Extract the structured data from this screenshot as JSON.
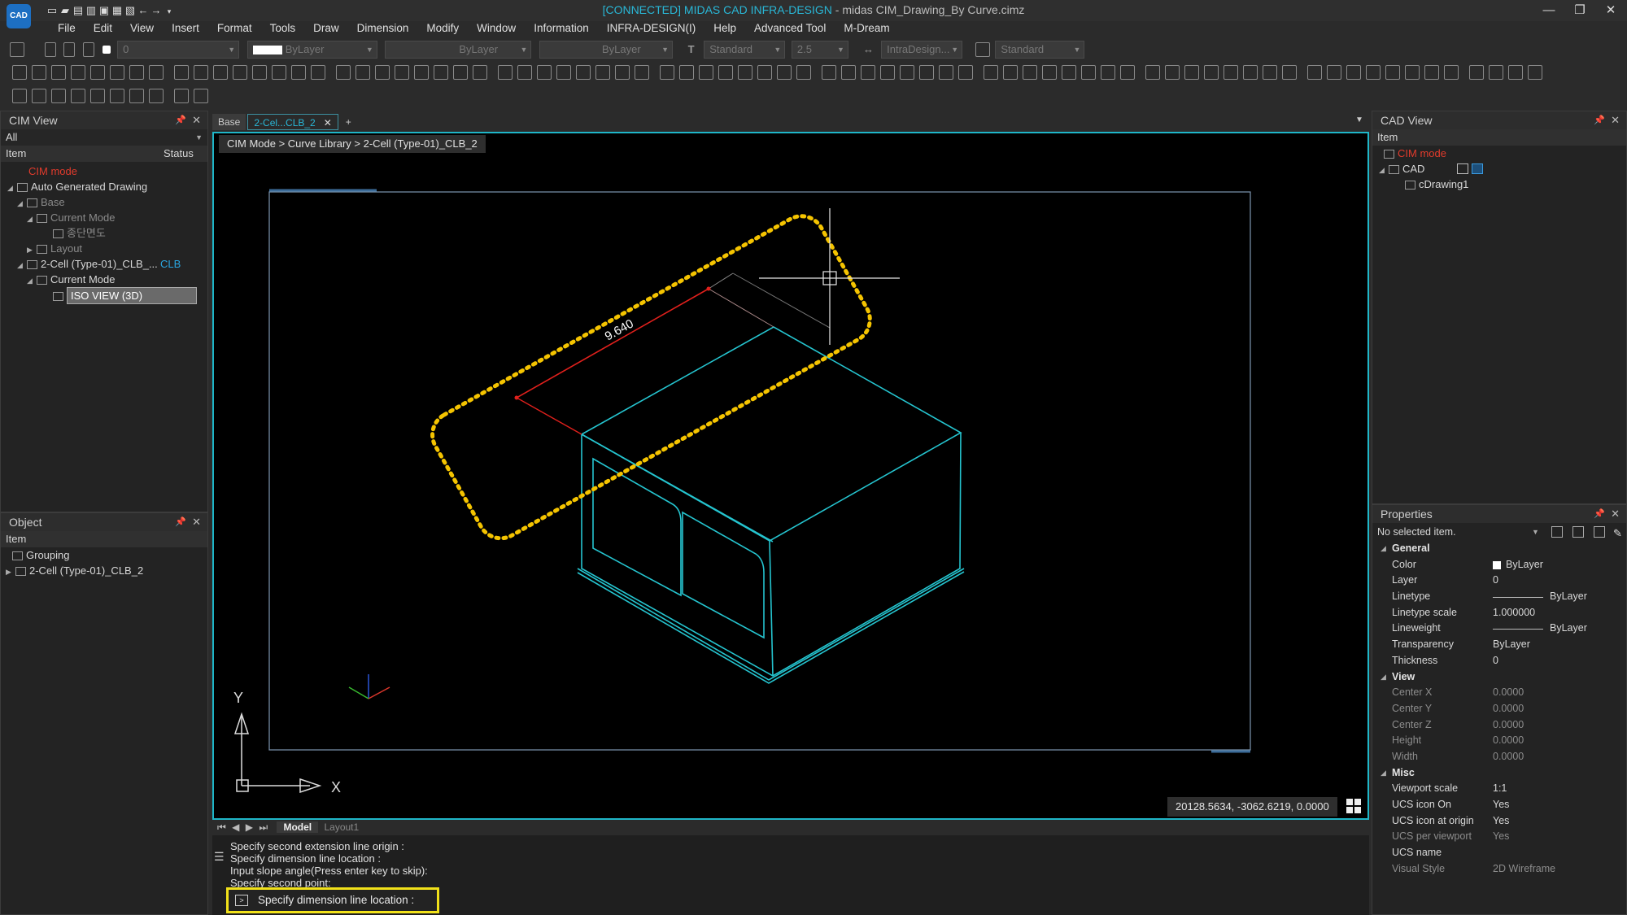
{
  "titlebar": {
    "logo_text": "CAD",
    "connected": "[CONNECTED] MIDAS CAD INFRA-DESIGN",
    "title_rest": " - midas CIM_Drawing_By Curve.cimz"
  },
  "menu": [
    "File",
    "Edit",
    "View",
    "Insert",
    "Format",
    "Tools",
    "Draw",
    "Dimension",
    "Modify",
    "Window",
    "Information",
    "INFRA-DESIGN(I)",
    "Help",
    "Advanced Tool",
    "M-Dream"
  ],
  "toolbar": {
    "layer_value": "0",
    "color_value": "ByLayer",
    "linetype_value": "ByLayer",
    "lineweight_value": "ByLayer",
    "textstyle_value": "Standard",
    "textsize_value": "2.5",
    "dimstyle_value": "IntraDesign...",
    "tablestyle_value": "Standard"
  },
  "cim_view": {
    "title": "CIM View",
    "filter": "All",
    "col_item": "Item",
    "col_status": "Status",
    "tree": {
      "cim_mode": "CIM mode",
      "auto_generated": "Auto Generated Drawing",
      "base": "Base",
      "current_mode_1": "Current Mode",
      "profile": "종단면도",
      "layout": "Layout",
      "cell": "2-Cell (Type-01)_CLB_...",
      "cell_status": "CLB",
      "current_mode_2": "Current Mode",
      "iso_view": "ISO VIEW (3D)"
    }
  },
  "object_panel": {
    "title": "Object",
    "col_item": "Item",
    "grouping": "Grouping",
    "cell": "2-Cell (Type-01)_CLB_2"
  },
  "doc_tabs": [
    "Base",
    "2-Cel...CLB_2"
  ],
  "add_tab": "+",
  "viewport": {
    "breadcrumb": "CIM Mode > Curve Library > 2-Cell (Type-01)_CLB_2",
    "dimension_text": "9.640",
    "coordinates": "20128.5634, -3062.6219, 0.0000",
    "axis_x": "X",
    "axis_y": "Y"
  },
  "layout_tabs": [
    "Model",
    "Layout1"
  ],
  "command": {
    "lines": [
      "Specify second extension line origin :",
      "Specify dimension line location :",
      "Input slope angle(Press enter key to skip):",
      "Specify second point:"
    ],
    "prompt": "Specify dimension line location :"
  },
  "cad_view": {
    "title": "CAD View",
    "col_item": "Item",
    "cim_mode": "CIM mode",
    "cad": "CAD",
    "drawing": "cDrawing1"
  },
  "properties": {
    "title": "Properties",
    "selection": "No selected item.",
    "general_label": "General",
    "general": [
      {
        "k": "Color",
        "v": "ByLayer"
      },
      {
        "k": "Layer",
        "v": "0"
      },
      {
        "k": "Linetype",
        "v": "ByLayer"
      },
      {
        "k": "Linetype scale",
        "v": "1.000000"
      },
      {
        "k": "Lineweight",
        "v": "ByLayer"
      },
      {
        "k": "Transparency",
        "v": "ByLayer"
      },
      {
        "k": "Thickness",
        "v": "0"
      }
    ],
    "view_label": "View",
    "view": [
      {
        "k": "Center X",
        "v": "0.0000"
      },
      {
        "k": "Center Y",
        "v": "0.0000"
      },
      {
        "k": "Center Z",
        "v": "0.0000"
      },
      {
        "k": "Height",
        "v": "0.0000"
      },
      {
        "k": "Width",
        "v": "0.0000"
      }
    ],
    "misc_label": "Misc",
    "misc": [
      {
        "k": "Viewport scale",
        "v": "1:1"
      },
      {
        "k": "UCS icon On",
        "v": "Yes"
      },
      {
        "k": "UCS icon at origin",
        "v": "Yes"
      },
      {
        "k": "UCS per viewport",
        "v": "Yes"
      },
      {
        "k": "UCS name",
        "v": ""
      },
      {
        "k": "Visual Style",
        "v": "2D Wireframe"
      }
    ]
  },
  "colors": {
    "accent": "#1fb6c8",
    "model_line": "#25c4cf",
    "dimension": "#e0201c",
    "highlight": "#f5c400",
    "cim_mode": "#e23b2c"
  }
}
